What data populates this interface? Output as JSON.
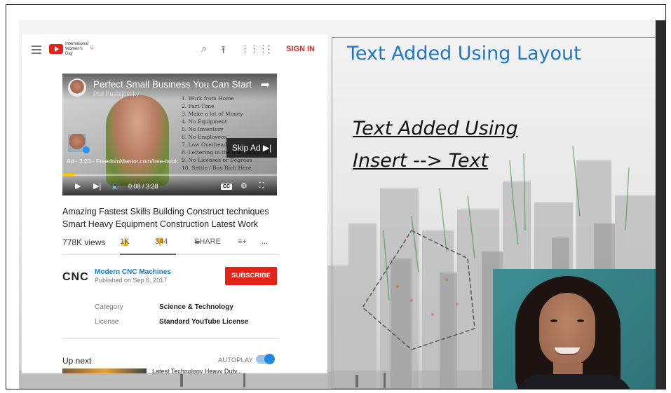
{
  "slide": {
    "layout_title": "Text Added Using Layout",
    "insert_text_line1": "Text Added Using",
    "insert_text_line2": "Insert --> Text",
    "accent_color": "#1f77d0"
  },
  "youtube": {
    "header": {
      "logo_caption": "International Women's Day",
      "signin_label": "SIGN IN",
      "icons": [
        "menu-icon",
        "youtube-logo-icon",
        "search-icon",
        "upload-icon",
        "apps-grid-icon",
        "more-vert-icon"
      ]
    },
    "player": {
      "title": "Perfect Small Business You Can Start",
      "channel": "Phil Pustejovsky",
      "whiteboard_lines": [
        "1. Work from Home",
        "2. Part-Time",
        "3. Make a lot of Money",
        "4. No Equipment",
        "5. No Inventory",
        "6. No Employees",
        "7. Low Overhead",
        "8. Lettering in the one Backyard",
        "9. No Licenses or Degrees",
        "10. Settle / Buy Rich Here"
      ],
      "ad_label": "Ad · 3:20 · FreedomMentor.com/free-book",
      "skip_label": "Skip Ad ▶|",
      "time_display": "0:08 / 3:28",
      "progress_fraction": 0.06,
      "cc_label": "CC"
    },
    "video": {
      "headline": "Amazing Fastest Skills Building Construct techniques Smart Heavy Equipment Construction Latest Work",
      "views": "778K views",
      "likes": "1K",
      "dislikes": "344",
      "share_label": "SHARE",
      "more_label": "..."
    },
    "owner": {
      "logo_text": "CNC",
      "name": "Modern CNC Machines",
      "published": "Published on Sep 6, 2017",
      "subscribe_label": "SUBSCRIBE"
    },
    "metadata": [
      {
        "key": "Category",
        "value": "Science & Technology"
      },
      {
        "key": "License",
        "value": "Standard YouTube License"
      }
    ],
    "upnext": {
      "label": "Up next",
      "autoplay_label": "AUTOPLAY",
      "autoplay_on": true,
      "next_title": "Latest Technology Heavy Duty..."
    }
  }
}
